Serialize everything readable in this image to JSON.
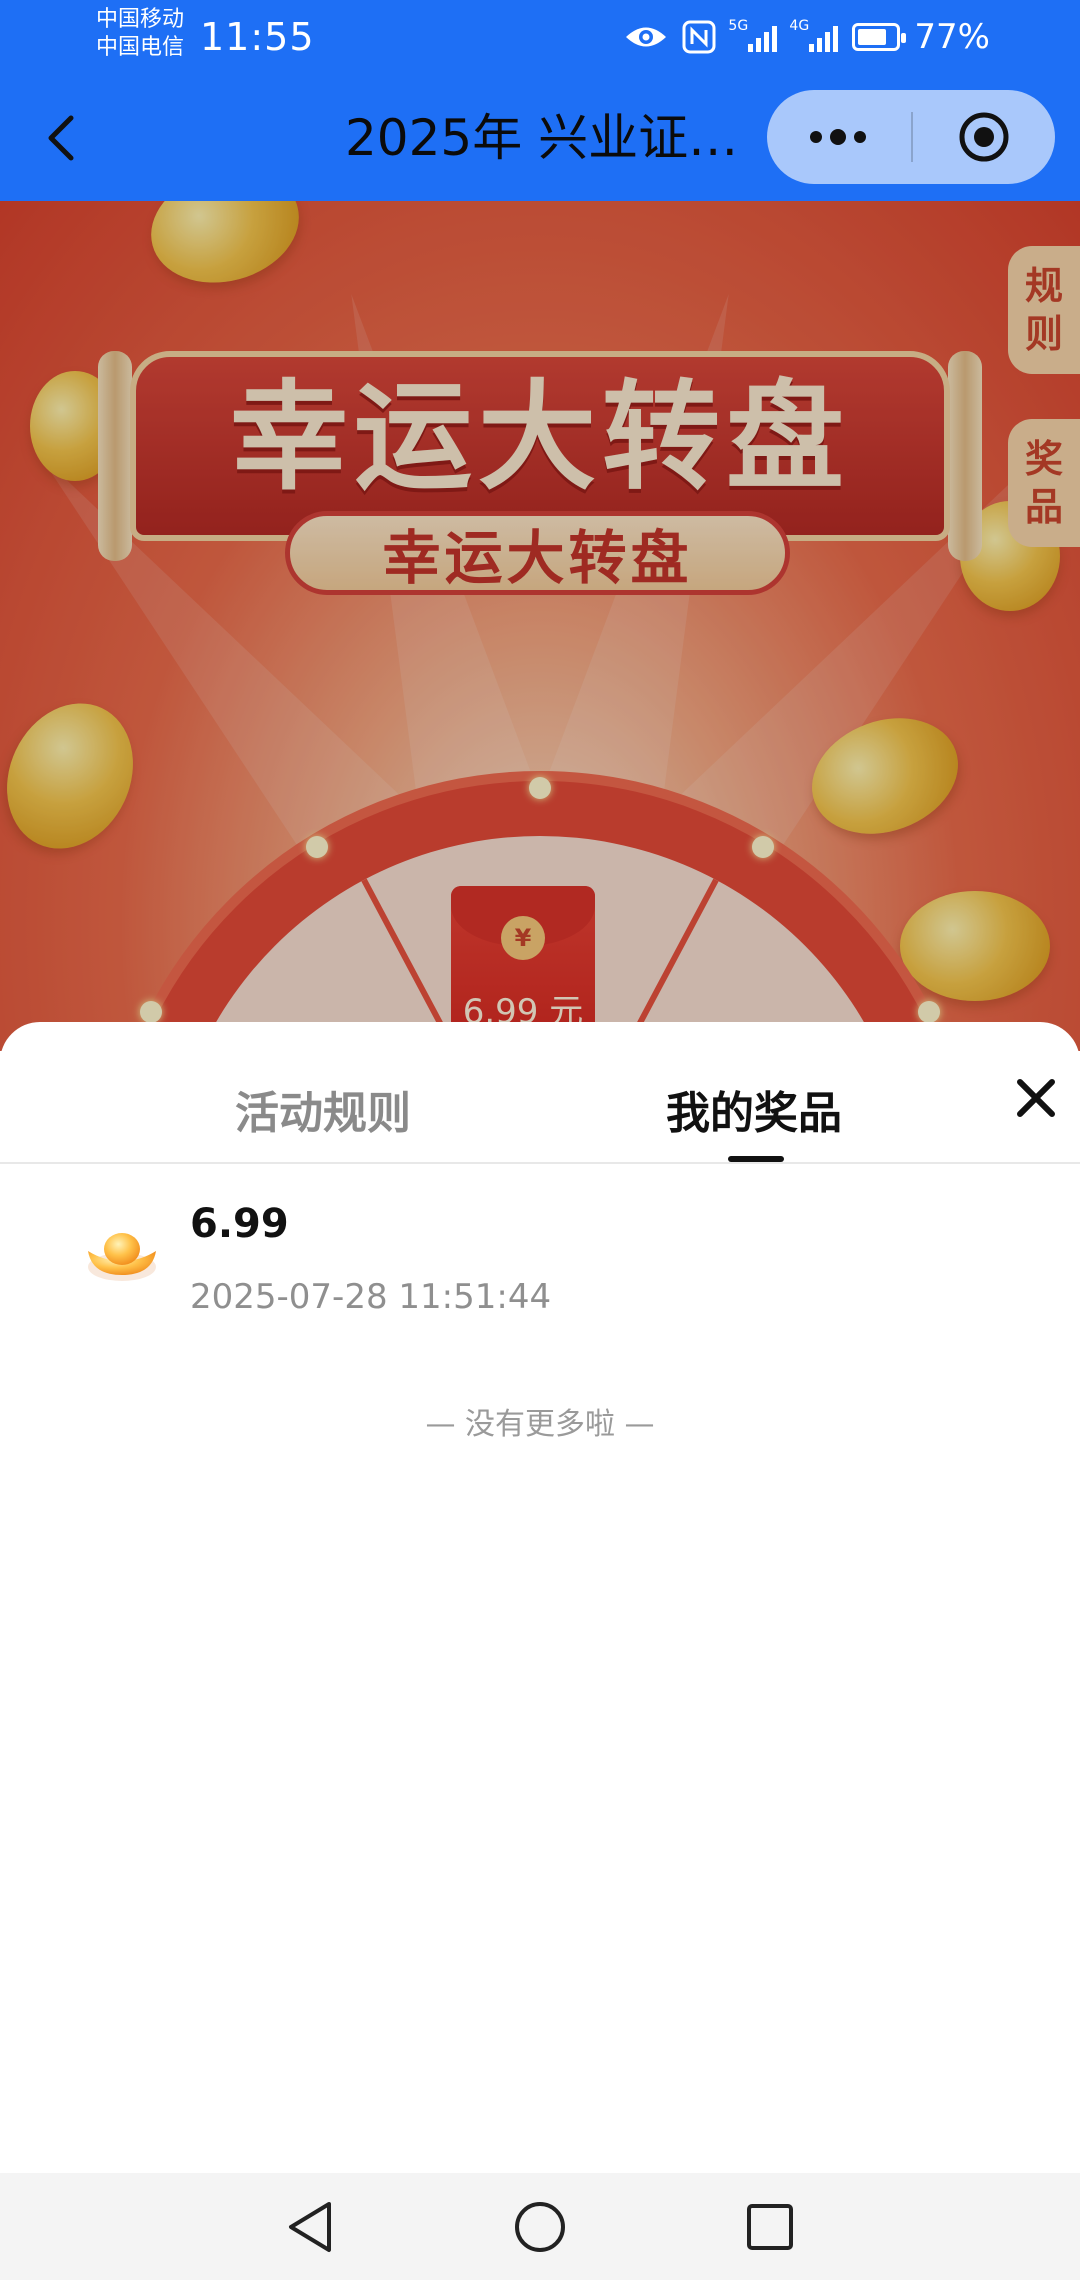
{
  "status_bar": {
    "carrier_1": "中国移动",
    "carrier_2": "中国电信",
    "time": "11:55",
    "network_5g": "5G",
    "network_4g": "4G",
    "battery": "77%"
  },
  "header": {
    "title": "2025年 兴业证…"
  },
  "banner": {
    "title": "幸运大转盘",
    "subtitle": "幸运大转盘",
    "side_tab_rules": [
      "规",
      "则"
    ],
    "side_tab_prizes": [
      "奖",
      "品"
    ],
    "wheel_prize": "6.99 元",
    "seal_symbol": "¥"
  },
  "sheet": {
    "tabs": [
      "活动规则",
      "我的奖品"
    ],
    "active_tab": "我的奖品",
    "prizes": [
      {
        "amount": "6.99",
        "time": "2025-07-28 11:51:44"
      }
    ],
    "footer_text": "— 没有更多啦 —"
  },
  "colors": {
    "brand_blue": "#1e6ff5",
    "banner_red": "#d9432e"
  }
}
